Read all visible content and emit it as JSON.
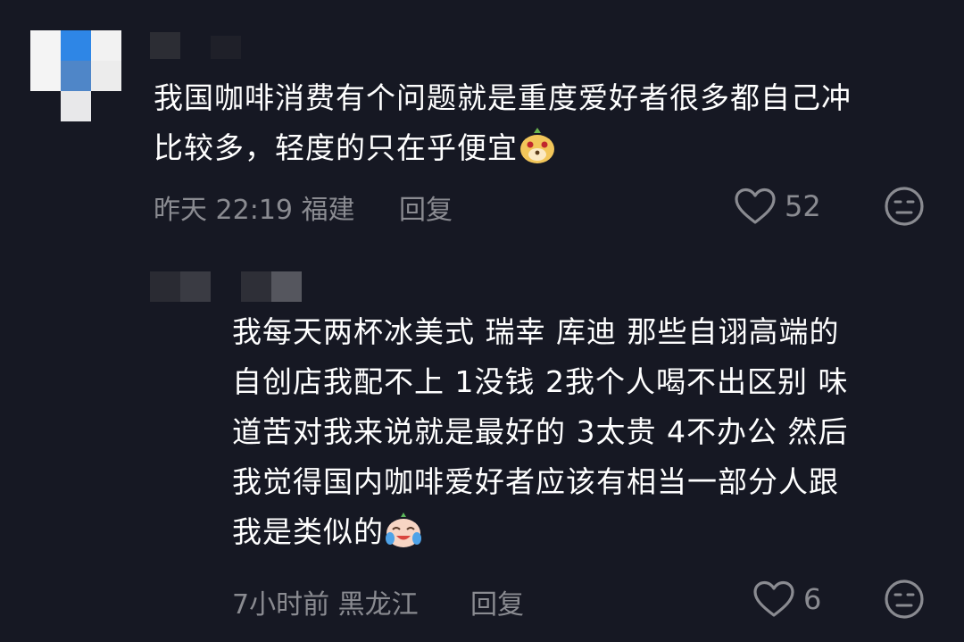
{
  "comments": [
    {
      "text_line1": "我国咖啡消费有个问题就是重度爱好者很多都自己冲",
      "text_line2": "比较多，轻度的只在乎便宜",
      "time": "昨天 22:19",
      "location": "福建",
      "reply_label": "回复",
      "likes": "52",
      "emoji_icon": "doge-emoji-icon"
    },
    {
      "lines": [
        "我每天两杯冰美式  瑞幸 库迪  那些自诩高端的",
        "自创店我配不上  1没钱  2我个人喝不出区别 味",
        "道苦对我来说就是最好的 3太贵 4不办公  然后",
        "我觉得国内咖啡爱好者应该有相当一部分人跟"
      ],
      "last_line": "我是类似的",
      "time": "7小时前",
      "location": "黑龙江",
      "reply_label": "回复",
      "likes": "6",
      "emoji_icon": "laugh-cry-emoji-icon"
    }
  ],
  "colors": {
    "background": "#161823",
    "text": "#ffffff",
    "meta": "#8a8b91"
  }
}
